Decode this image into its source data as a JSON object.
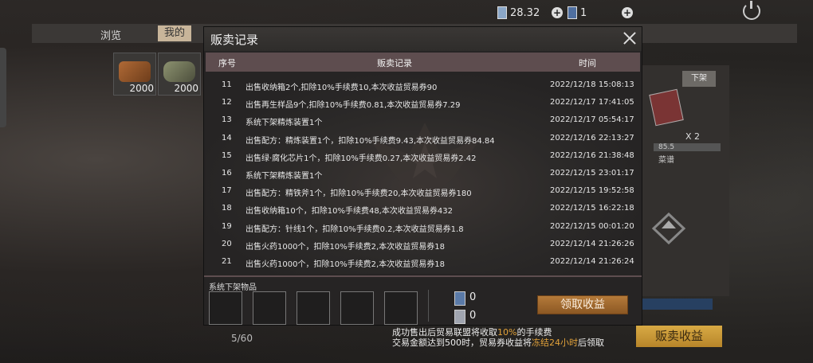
{
  "topbar": {
    "ticket_value": "28.32",
    "card_value": "1",
    "ticket_icon": "ticket-icon",
    "card_icon": "card-icon"
  },
  "tabs": [
    {
      "label": "浏览"
    },
    {
      "label": "我的"
    }
  ],
  "inventory": [
    {
      "icon": "wood-logs-icon",
      "count": "2000"
    },
    {
      "icon": "metal-scrap-icon",
      "count": "2000"
    }
  ],
  "right_panel": {
    "offshelf_label": "下架",
    "qty": "X 2",
    "value": "85.5",
    "recipe_label": "菜谱"
  },
  "footer": {
    "page": "5/60",
    "info_line1_a": "成功售出后贸易联盟将收取",
    "info_line1_hl": "10%",
    "info_line1_b": "的手续费",
    "info_line2_a": "交易金额达到500时，贸易券收益将",
    "info_line2_hl": "冻结24小时",
    "info_line2_b": "后领取",
    "sell_income_label": "贩卖收益"
  },
  "modal": {
    "title": "贩卖记录",
    "headers": {
      "no": "序号",
      "record": "贩卖记录",
      "time": "时间"
    },
    "rows": [
      {
        "no": "11",
        "text": "出售收纳箱2个,扣除10%手续费10,本次收益贸易券90",
        "time": "2022/12/18 15:08:13"
      },
      {
        "no": "12",
        "text": "出售再生样品9个,扣除10%手续费0.81,本次收益贸易券7.29",
        "time": "2022/12/17 17:41:05"
      },
      {
        "no": "13",
        "text": "系统下架精炼装置1个",
        "time": "2022/12/17 05:54:17"
      },
      {
        "no": "14",
        "text": "出售配方：精炼装置1个，扣除10%手续费9.43,本次收益贸易券84.84",
        "time": "2022/12/16 22:13:27"
      },
      {
        "no": "15",
        "text": "出售绿·腐化芯片1个，扣除10%手续费0.27,本次收益贸易券2.42",
        "time": "2022/12/16 21:38:48"
      },
      {
        "no": "16",
        "text": "系统下架精炼装置1个",
        "time": "2022/12/15 23:01:17"
      },
      {
        "no": "17",
        "text": "出售配方：精铁斧1个，扣除10%手续费20,本次收益贸易券180",
        "time": "2022/12/15 19:52:58"
      },
      {
        "no": "18",
        "text": "出售收纳箱10个，扣除10%手续费48,本次收益贸易券432",
        "time": "2022/12/15 16:22:18"
      },
      {
        "no": "19",
        "text": "出售配方：针线1个，扣除10%手续费0.2,本次收益贸易券1.8",
        "time": "2022/12/15 00:01:20"
      },
      {
        "no": "20",
        "text": "出售火药1000个，扣除10%手续费2,本次收益贸易券18",
        "time": "2022/12/14 21:26:26"
      },
      {
        "no": "21",
        "text": "出售火药1000个，扣除10%手续费2,本次收益贸易券18",
        "time": "2022/12/14 21:26:24"
      }
    ],
    "section_label": "系统下架物品",
    "ticket_a_value": "0",
    "ticket_b_value": "0",
    "claim_label": "领取收益"
  }
}
